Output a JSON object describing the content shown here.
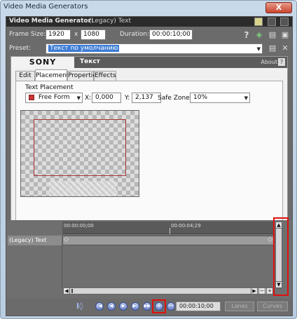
{
  "window": {
    "title": "Video Media Generators",
    "close_label": "X"
  },
  "header": {
    "title": "Video Media Generator:",
    "name": "(Legacy) Text"
  },
  "frame": {
    "size_label": "Frame Size:",
    "width": "1920",
    "x_label": "x",
    "height": "1080",
    "duration_label": "Duration:",
    "duration": "00:00:10;00"
  },
  "preset": {
    "label": "Preset:",
    "value": "Текст по умолчанию"
  },
  "plugin": {
    "brand": "SONY",
    "title": "Текст",
    "about": "About",
    "help": "?"
  },
  "tabs": [
    {
      "label": "Edit",
      "active": false
    },
    {
      "label": "Placement",
      "active": true
    },
    {
      "label": "Properties",
      "active": false
    },
    {
      "label": "Effects",
      "active": false
    }
  ],
  "placement": {
    "section_label": "Text Placement",
    "mode": "Free Form",
    "x_label": "X:",
    "x_value": "0,000",
    "y_label": "Y:",
    "y_value": "2,137",
    "safe_zone_label": "Safe Zone:",
    "safe_zone_value": "10%"
  },
  "timeline": {
    "time_start": "00:00:00;00",
    "time_mid": "00:00:04;29",
    "track_name": "(Legacy) Text"
  },
  "transport": {
    "time": "00:00:10;00",
    "lanes_label": "Lanes",
    "curves_label": "Curves"
  },
  "colors": {
    "highlight": "#e01010",
    "preset_selection": "#3a7bd5"
  }
}
